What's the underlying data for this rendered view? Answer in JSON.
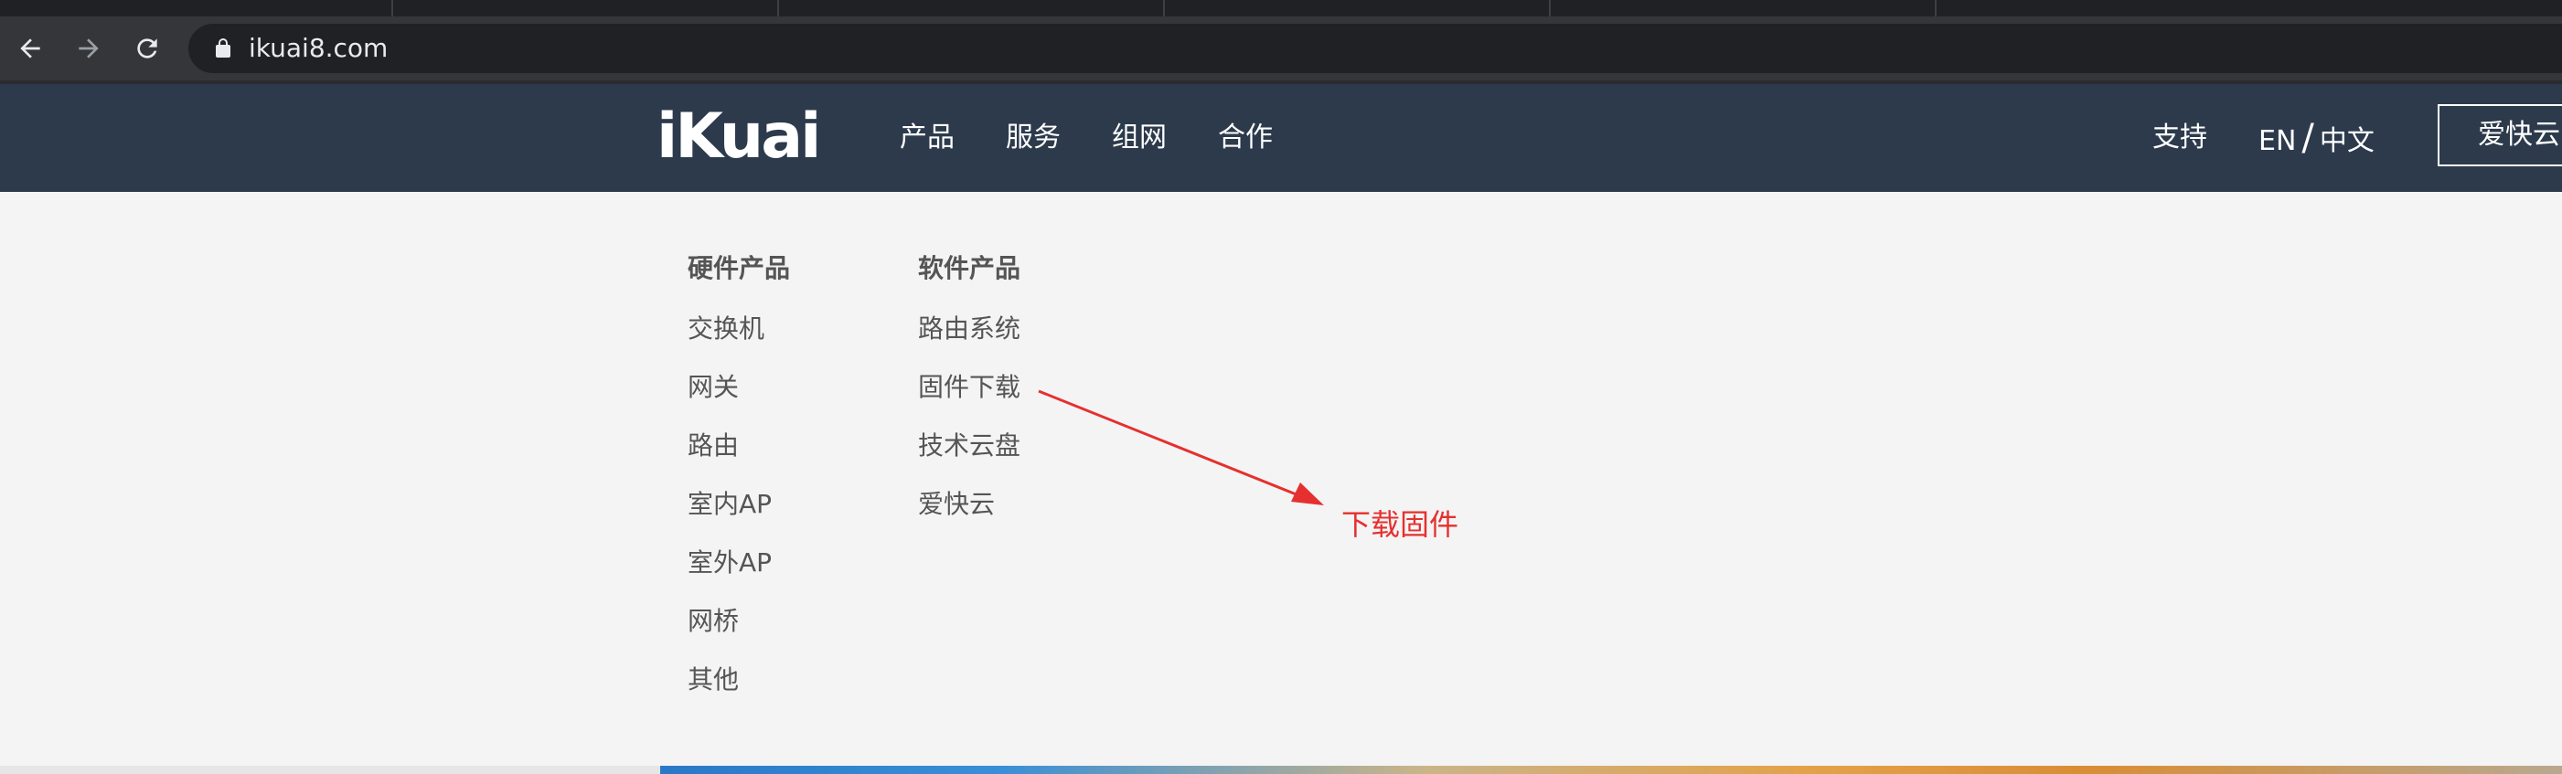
{
  "browser": {
    "url": "ikuai8.com",
    "icons": {
      "back": "back-arrow-icon",
      "forward": "forward-arrow-icon",
      "reload": "reload-icon",
      "lock": "lock-icon"
    }
  },
  "header": {
    "logo": "iKuai",
    "nav": [
      {
        "label": "产品"
      },
      {
        "label": "服务"
      },
      {
        "label": "组网"
      },
      {
        "label": "合作"
      }
    ],
    "support_label": "支持",
    "lang_en": "EN",
    "lang_sep": "/",
    "lang_zh": "中文",
    "cloud_button": "爱快云",
    "colors": {
      "background": "#2c3a4c",
      "text": "#ffffff"
    }
  },
  "dropdown": {
    "hardware": {
      "title": "硬件产品",
      "items": [
        "交换机",
        "网关",
        "路由",
        "室内AP",
        "室外AP",
        "网桥",
        "其他"
      ]
    },
    "software": {
      "title": "软件产品",
      "items": [
        "路由系统",
        "固件下载",
        "技术云盘",
        "爱快云"
      ]
    }
  },
  "annotation": {
    "label": "下载固件",
    "color": "#e5302f"
  }
}
